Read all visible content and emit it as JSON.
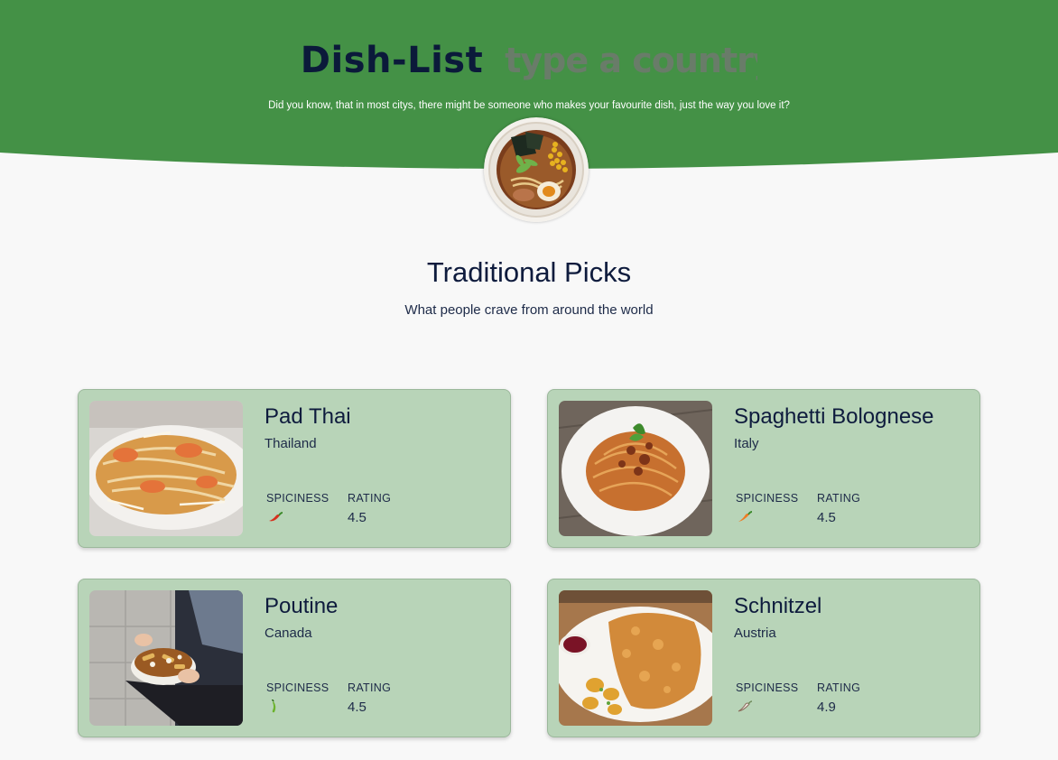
{
  "header": {
    "brand": "Dish-List",
    "search_placeholder": "type a country",
    "tagline": "Did you know, that in most citys, there might be someone who makes your favourite dish, just the way you love it?",
    "bg_color": "#449146"
  },
  "section": {
    "title": "Traditional Picks",
    "subtitle": "What people crave from around the world"
  },
  "labels": {
    "spiciness": "SPICINESS",
    "rating": "RATING"
  },
  "dishes": [
    {
      "name": "Pad Thai",
      "country": "Thailand",
      "rating": "4.5",
      "spice_icon": "red-chili-icon"
    },
    {
      "name": "Spaghetti Bolognese",
      "country": "Italy",
      "rating": "4.5",
      "spice_icon": "orange-chili-icon"
    },
    {
      "name": "Poutine",
      "country": "Canada",
      "rating": "4.5",
      "spice_icon": "green-chili-icon"
    },
    {
      "name": "Schnitzel",
      "country": "Austria",
      "rating": "4.9",
      "spice_icon": "outline-chili-icon"
    }
  ],
  "colors": {
    "card_bg": "#b8d4b8",
    "text_dark": "#0e1b3d"
  }
}
